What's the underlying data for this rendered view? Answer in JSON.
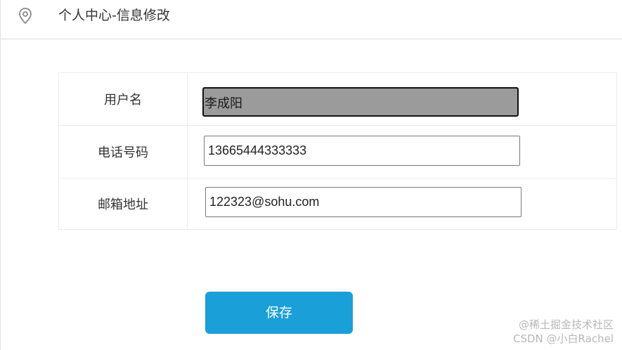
{
  "header": {
    "title": "个人中心-信息修改",
    "icon": "location-pin-icon"
  },
  "form": {
    "rows": [
      {
        "label": "用户名",
        "value": "李成阳",
        "readonly": true
      },
      {
        "label": "电话号码",
        "value": "13665444333333",
        "readonly": false
      },
      {
        "label": "邮箱地址",
        "value": "122323@sohu.com",
        "readonly": false
      }
    ],
    "save_label": "保存"
  },
  "watermark": {
    "line1": "@稀土掘金技术社区",
    "line2": "CSDN @小白Rachel"
  },
  "colors": {
    "save_button": "#1a9fd9",
    "readonly_field": "#9b9b9b"
  }
}
